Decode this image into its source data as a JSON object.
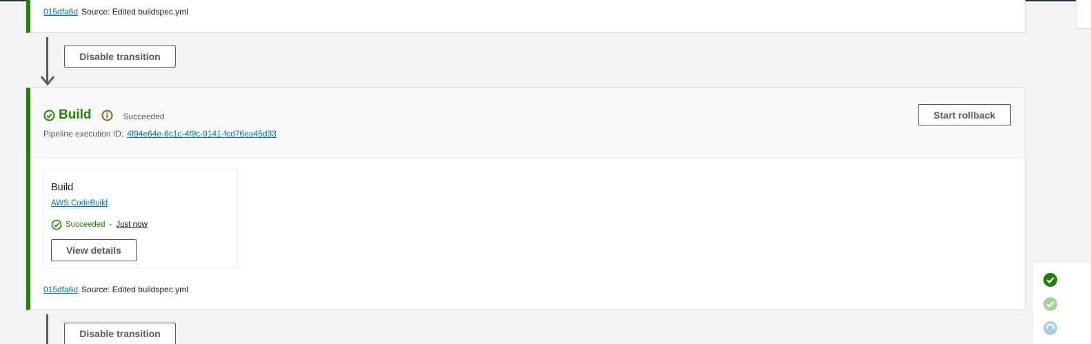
{
  "previous_stage": {
    "commit_id": "015dfa6d",
    "source_text": "Source: Edited buildspec.yml"
  },
  "transition_1": {
    "disable_label": "Disable transition"
  },
  "build_stage": {
    "title": "Build",
    "status": "Succeeded",
    "exec_label": "Pipeline execution ID:",
    "exec_id": "4f94e64e-6c1c-4f9c-9141-fcd76ea45d33",
    "rollback_label": "Start rollback",
    "action": {
      "name": "Build",
      "provider": "AWS CodeBuild",
      "status": "Succeeded",
      "separator": "-",
      "time": "Just now",
      "view_details_label": "View details"
    },
    "commit_id": "015dfa6d",
    "source_text": "Source: Edited buildspec.yml"
  },
  "transition_2": {
    "disable_label": "Disable transition"
  },
  "colors": {
    "success": "#1d8102",
    "link": "#0073bb",
    "info": "#8d6605",
    "border": "#545b64"
  },
  "icons": {
    "stage_status": "check-circle-icon",
    "info": "info-icon",
    "action_status": "check-circle-icon",
    "side_1": "check-circle-filled-icon",
    "side_2": "check-circle-light-icon",
    "side_3": "in-progress-icon"
  }
}
